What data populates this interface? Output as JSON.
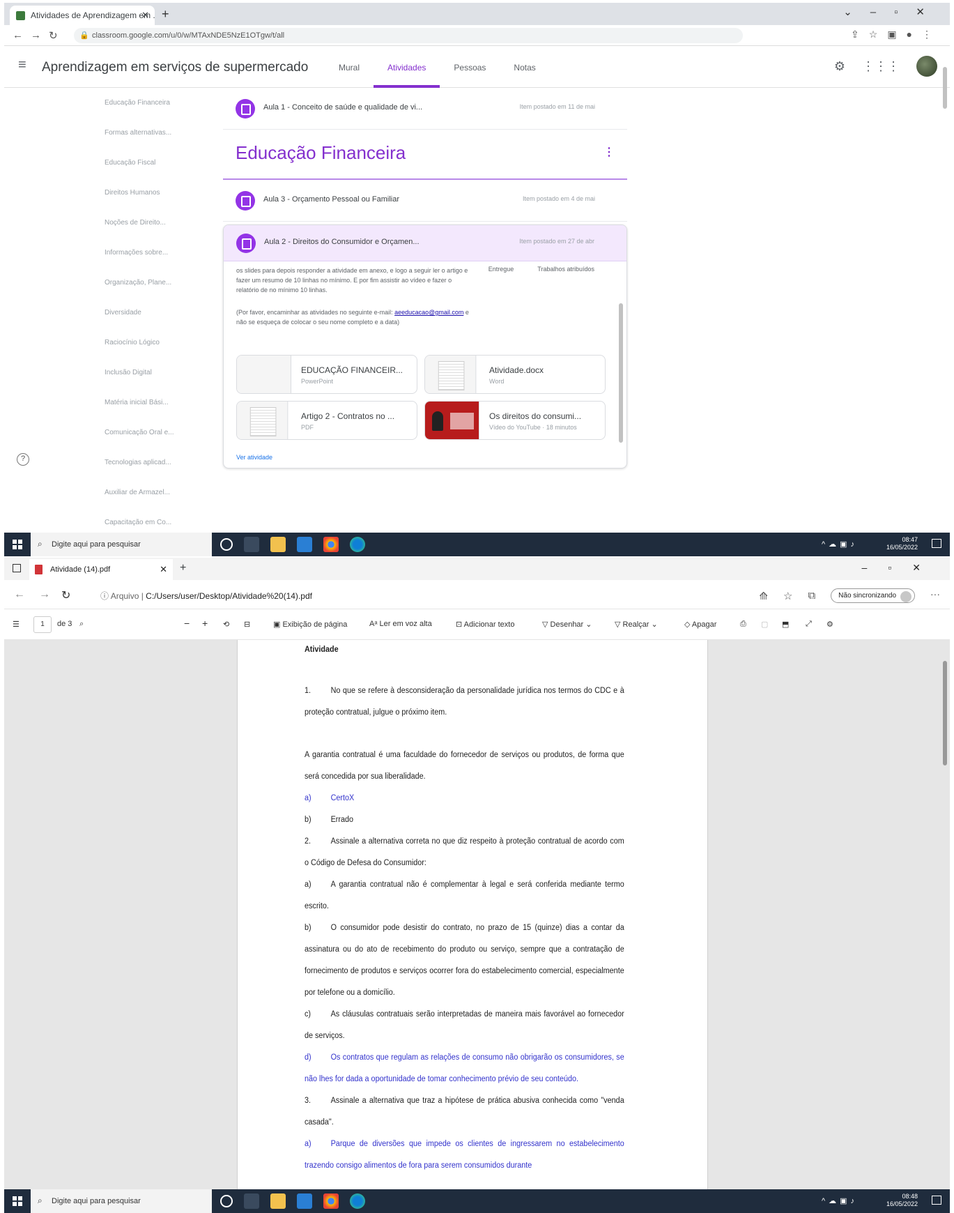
{
  "top": {
    "tab_title": "Atividades de Aprendizagem em ...",
    "url": "classroom.google.com/u/0/w/MTAxNDE5NzE1OTgw/t/all",
    "course_title": "Aprendizagem em serviços de supermercado",
    "tabs": [
      {
        "label": "Mural"
      },
      {
        "label": "Atividades"
      },
      {
        "label": "Pessoas"
      },
      {
        "label": "Notas"
      }
    ],
    "sidebar_items": [
      "Educação Financeira",
      "Formas alternativas...",
      "Educação Fiscal",
      "Direitos Humanos",
      "Noções de Direito...",
      "Informações sobre...",
      "Organização, Plane...",
      "Diversidade",
      "Raciocínio Lógico",
      "Inclusão Digital",
      "Matéria inicial Bási...",
      "Comunicação Oral e...",
      "Tecnologias aplicad...",
      "Auxiliar de Armazel...",
      "Capacitação em Co..."
    ],
    "row1": {
      "title": "Aula 1 - Conceito de saúde e qualidade de vi...",
      "date": "Item postado em 11 de mai"
    },
    "section_title": "Educação Financeira",
    "row2": {
      "title": "Aula 3 - Orçamento Pessoal ou Familiar",
      "date": "Item postado em 4 de mai"
    },
    "expanded": {
      "title": "Aula 2 - Direitos do Consumidor e Orçamen...",
      "date": "Item postado em 27 de abr",
      "body1": "os slides para depois responder a atividade em anexo, e logo a seguir ler o artigo e fazer um resumo de 10 linhas no mínimo. E por fim assistir ao vídeo e fazer o relatório de no mínimo 10 linhas.",
      "body2_pre": "(Por favor, encaminhar as atividades no seguinte e-mail:",
      "body2_link": "aeeducacao@gmail.com",
      "body2_post": "e não se esqueça de colocar o seu nome completo e a data)",
      "stat1": "Entregue",
      "stat2": "Trabalhos atribuídos",
      "materials": [
        {
          "title": "EDUCAÇÃO FINANCEIR...",
          "sub": "PowerPoint"
        },
        {
          "title": "Atividade.docx",
          "sub": "Word"
        },
        {
          "title": "Artigo 2 - Contratos no ...",
          "sub": "PDF"
        },
        {
          "title": "Os direitos do consumi...",
          "sub": "Vídeo do YouTube · 18 minutos"
        }
      ],
      "view_link": "Ver atividade"
    },
    "taskbar": {
      "search": "Digite aqui para pesquisar",
      "time": "08:47",
      "date": "16/05/2022"
    }
  },
  "bottom": {
    "tab_title": "Atividade (14).pdf",
    "url_prefix": "Arquivo",
    "url": "C:/Users/user/Desktop/Atividade%20(14).pdf",
    "sync_label": "Não sincronizando",
    "page_num": "1",
    "page_total": "de 3",
    "toolbar": {
      "page_view": "Exibição de página",
      "read_aloud": "Ler em voz alta",
      "add_text": "Adicionar texto",
      "draw": "Desenhar",
      "highlight": "Realçar",
      "erase": "Apagar"
    },
    "doc": {
      "heading": "Atividade",
      "q1_num": "1.",
      "q1": "No que se refere à desconsideração da personalidade jurídica nos termos do CDC e à proteção contratual, julgue o próximo item.",
      "q1_stmt": "A garantia contratual é uma faculdade do fornecedor de serviços ou produtos, de forma que será concedida por sua liberalidade.",
      "q1_a_lbl": "a)",
      "q1_a": "CertoX",
      "q1_b_lbl": "b)",
      "q1_b": "Errado",
      "q2_num": "2.",
      "q2": "Assinale a alternativa correta no que diz respeito à proteção contratual de acordo com o Código de Defesa do Consumidor:",
      "q2_a_lbl": "a)",
      "q2_a": "A garantia contratual não é complementar à legal e será conferida mediante termo escrito.",
      "q2_b_lbl": "b)",
      "q2_b": "O consumidor pode desistir do contrato, no prazo de 15 (quinze) dias a contar da assinatura ou do ato de recebimento do produto ou serviço, sempre que a contratação de fornecimento de produtos e serviços ocorrer fora do estabelecimento comercial, especialmente por telefone ou a domicílio.",
      "q2_c_lbl": "c)",
      "q2_c": "As cláusulas contratuais serão interpretadas de maneira mais favorável ao fornecedor de serviços.",
      "q2_d_lbl": "d)",
      "q2_d": "Os contratos que regulam as relações de consumo não obrigarão os consumidores, se não lhes for dada a oportunidade de tomar conhecimento prévio de seu conteúdo.",
      "q3_num": "3.",
      "q3": "Assinale a alternativa que traz a hipótese de prática abusiva conhecida como \"venda casada\".",
      "q3_a_lbl": "a)",
      "q3_a": "Parque de diversões que impede os clientes de ingressarem no estabelecimento trazendo consigo alimentos de fora para serem consumidos durante"
    },
    "taskbar": {
      "search": "Digite aqui para pesquisar",
      "time": "08:48",
      "date": "16/05/2022"
    }
  },
  "colors": {
    "classroom_accent": "#8430ce",
    "link": "#3333cc",
    "taskbar": "#1f2c3d"
  }
}
